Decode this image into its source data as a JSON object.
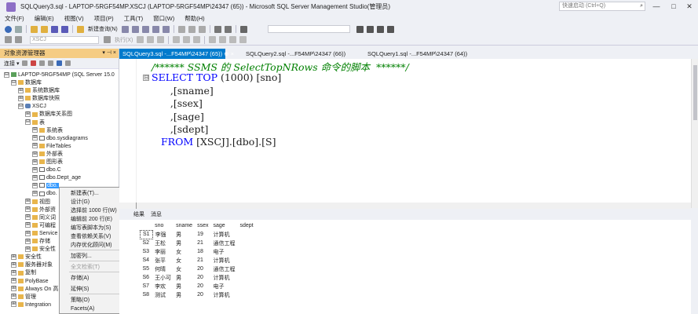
{
  "window": {
    "title": "SQLQuery3.sql - LAPTOP-5RGF54MP.XSCJ (LAPTOP-5RGF54MP\\24347 (65)) - Microsoft SQL Server Management Studio(管理员)",
    "quick_launch_placeholder": "快速启动 (Ctrl+Q)",
    "minimize": "—",
    "maximize": "□",
    "close": "✕"
  },
  "menu": [
    "文件(F)",
    "编辑(E)",
    "视图(V)",
    "项目(P)",
    "工具(T)",
    "窗口(W)",
    "帮助(H)"
  ],
  "toolbar": {
    "new_query": "新建查询(N)",
    "database_combo": "XSCJ",
    "execute": "执行(X)"
  },
  "object_explorer": {
    "title": "对象资源管理器",
    "header_btns": "▾ ⊣ ×",
    "connect": "连接 ▾",
    "server": "LAPTOP-5RGF54MP (SQL Server 15.0",
    "tree": [
      {
        "label": "数据库",
        "exp": "⊟",
        "icon": "folder"
      },
      {
        "label": "系统数据库",
        "exp": "⊞",
        "icon": "folder"
      },
      {
        "label": "数据库快照",
        "exp": "⊞",
        "icon": "folder"
      },
      {
        "label": "XSCJ",
        "exp": "⊟",
        "icon": "db"
      },
      {
        "label": "数据库关系图",
        "exp": "⊞",
        "icon": "folder"
      },
      {
        "label": "表",
        "exp": "⊟",
        "icon": "folder"
      },
      {
        "label": "系统表",
        "exp": "⊞",
        "icon": "folder"
      },
      {
        "label": "dbo.sysdiagrams",
        "exp": "⊞",
        "icon": "table"
      },
      {
        "label": "FileTables",
        "exp": "⊞",
        "icon": "folder"
      },
      {
        "label": "外部表",
        "exp": "⊞",
        "icon": "folder"
      },
      {
        "label": "图形表",
        "exp": "⊞",
        "icon": "folder"
      },
      {
        "label": "dbo.C",
        "exp": "⊞",
        "icon": "table"
      },
      {
        "label": "dbo.Dept_age",
        "exp": "⊞",
        "icon": "table"
      },
      {
        "label": "dbo.",
        "exp": "⊞",
        "icon": "table"
      },
      {
        "label": "dbo.",
        "exp": "⊞",
        "icon": "table"
      },
      {
        "label": "视图",
        "exp": "⊞",
        "icon": "folder"
      },
      {
        "label": "外部资",
        "exp": "⊞",
        "icon": "folder"
      },
      {
        "label": "同义词",
        "exp": "⊞",
        "icon": "folder"
      },
      {
        "label": "可编程",
        "exp": "⊞",
        "icon": "folder"
      },
      {
        "label": "Service",
        "exp": "⊞",
        "icon": "folder"
      },
      {
        "label": "存储",
        "exp": "⊞",
        "icon": "folder"
      },
      {
        "label": "安全性",
        "exp": "⊞",
        "icon": "folder"
      },
      {
        "label": "安全性",
        "exp": "⊞",
        "icon": "folder"
      },
      {
        "label": "服务器对象",
        "exp": "⊞",
        "icon": "folder"
      },
      {
        "label": "复制",
        "exp": "⊞",
        "icon": "folder"
      },
      {
        "label": "PolyBase",
        "exp": "⊞",
        "icon": "folder"
      },
      {
        "label": "Always On 高",
        "exp": "⊞",
        "icon": "folder"
      },
      {
        "label": "管理",
        "exp": "⊞",
        "icon": "folder"
      },
      {
        "label": "Integration",
        "exp": "⊞",
        "icon": "folder"
      }
    ]
  },
  "context_menu": [
    {
      "label": "新建表(T)...",
      "arrow": ""
    },
    {
      "label": "设计(G)",
      "arrow": ""
    },
    {
      "label": "选择前 1000 行(W)",
      "arrow": ""
    },
    {
      "label": "编辑前 200 行(E)",
      "arrow": ""
    },
    {
      "label": "编写表脚本为(S)",
      "arrow": "▸"
    },
    {
      "label": "查看依赖关系(V)",
      "arrow": ""
    },
    {
      "label": "内存优化顾问(M)",
      "arrow": ""
    },
    {
      "label": "加密列...",
      "arrow": ""
    },
    {
      "label": "全文检索(T)",
      "arrow": "▸"
    },
    {
      "label": "存储(A)",
      "arrow": "▸"
    },
    {
      "label": "延伸(S)",
      "arrow": "▸"
    },
    {
      "label": "策略(O)",
      "arrow": "▸"
    },
    {
      "label": "Facets(A)",
      "arrow": ""
    }
  ],
  "tabs": [
    "SQLQuery3.sql -...F54MP\\24347 (65))  ⊕  ×",
    "SQLQuery2.sql -...F54MP\\24347 (66))",
    "SQLQuery1.sql -...F54MP\\24347 (64))"
  ],
  "code": {
    "line1": "/****** SSMS 的 SelectTopNRows 命令的脚本  ******/",
    "line2_kw1": "SELECT TOP",
    "line2_rest": " (1000) [sno]",
    "line3": "      ,[sname]",
    "line4": "      ,[ssex]",
    "line5": "      ,[sage]",
    "line6": "      ,[sdept]",
    "line7_kw": "FROM",
    "line7_rest": " [XSCJ].[dbo].[S]",
    "collapse_marker": "⊟"
  },
  "results": {
    "tab_results": "结果",
    "tab_messages": "消息",
    "columns": [
      "sno",
      "sname",
      "ssex",
      "sage",
      "sdept"
    ],
    "rows": [
      [
        "S1",
        "李强",
        "男",
        "19",
        "计算机"
      ],
      [
        "S2",
        "王松",
        "男",
        "21",
        "通信工程"
      ],
      [
        "S3",
        "李丽",
        "女",
        "18",
        "电子"
      ],
      [
        "S4",
        "张平",
        "女",
        "21",
        "计算机"
      ],
      [
        "S5",
        "何晴",
        "女",
        "20",
        "通信工程"
      ],
      [
        "S6",
        "王小可",
        "男",
        "20",
        "计算机"
      ],
      [
        "S7",
        "李欢",
        "男",
        "20",
        "电子"
      ],
      [
        "S8",
        "测试",
        "男",
        "20",
        "计算机"
      ]
    ]
  }
}
